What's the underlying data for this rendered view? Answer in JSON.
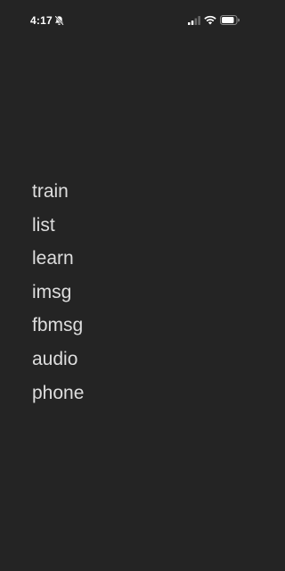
{
  "status_bar": {
    "time": "4:17",
    "icons": [
      "bell-slash-icon",
      "cellular-signal-icon",
      "wifi-icon",
      "battery-icon"
    ]
  },
  "menu": {
    "items": [
      {
        "label": "train"
      },
      {
        "label": "list"
      },
      {
        "label": "learn"
      },
      {
        "label": "imsg"
      },
      {
        "label": "fbmsg"
      },
      {
        "label": "audio"
      },
      {
        "label": "phone"
      }
    ]
  },
  "colors": {
    "background": "#242424",
    "menu_text": "#dedede",
    "status_text": "#ffffff"
  }
}
